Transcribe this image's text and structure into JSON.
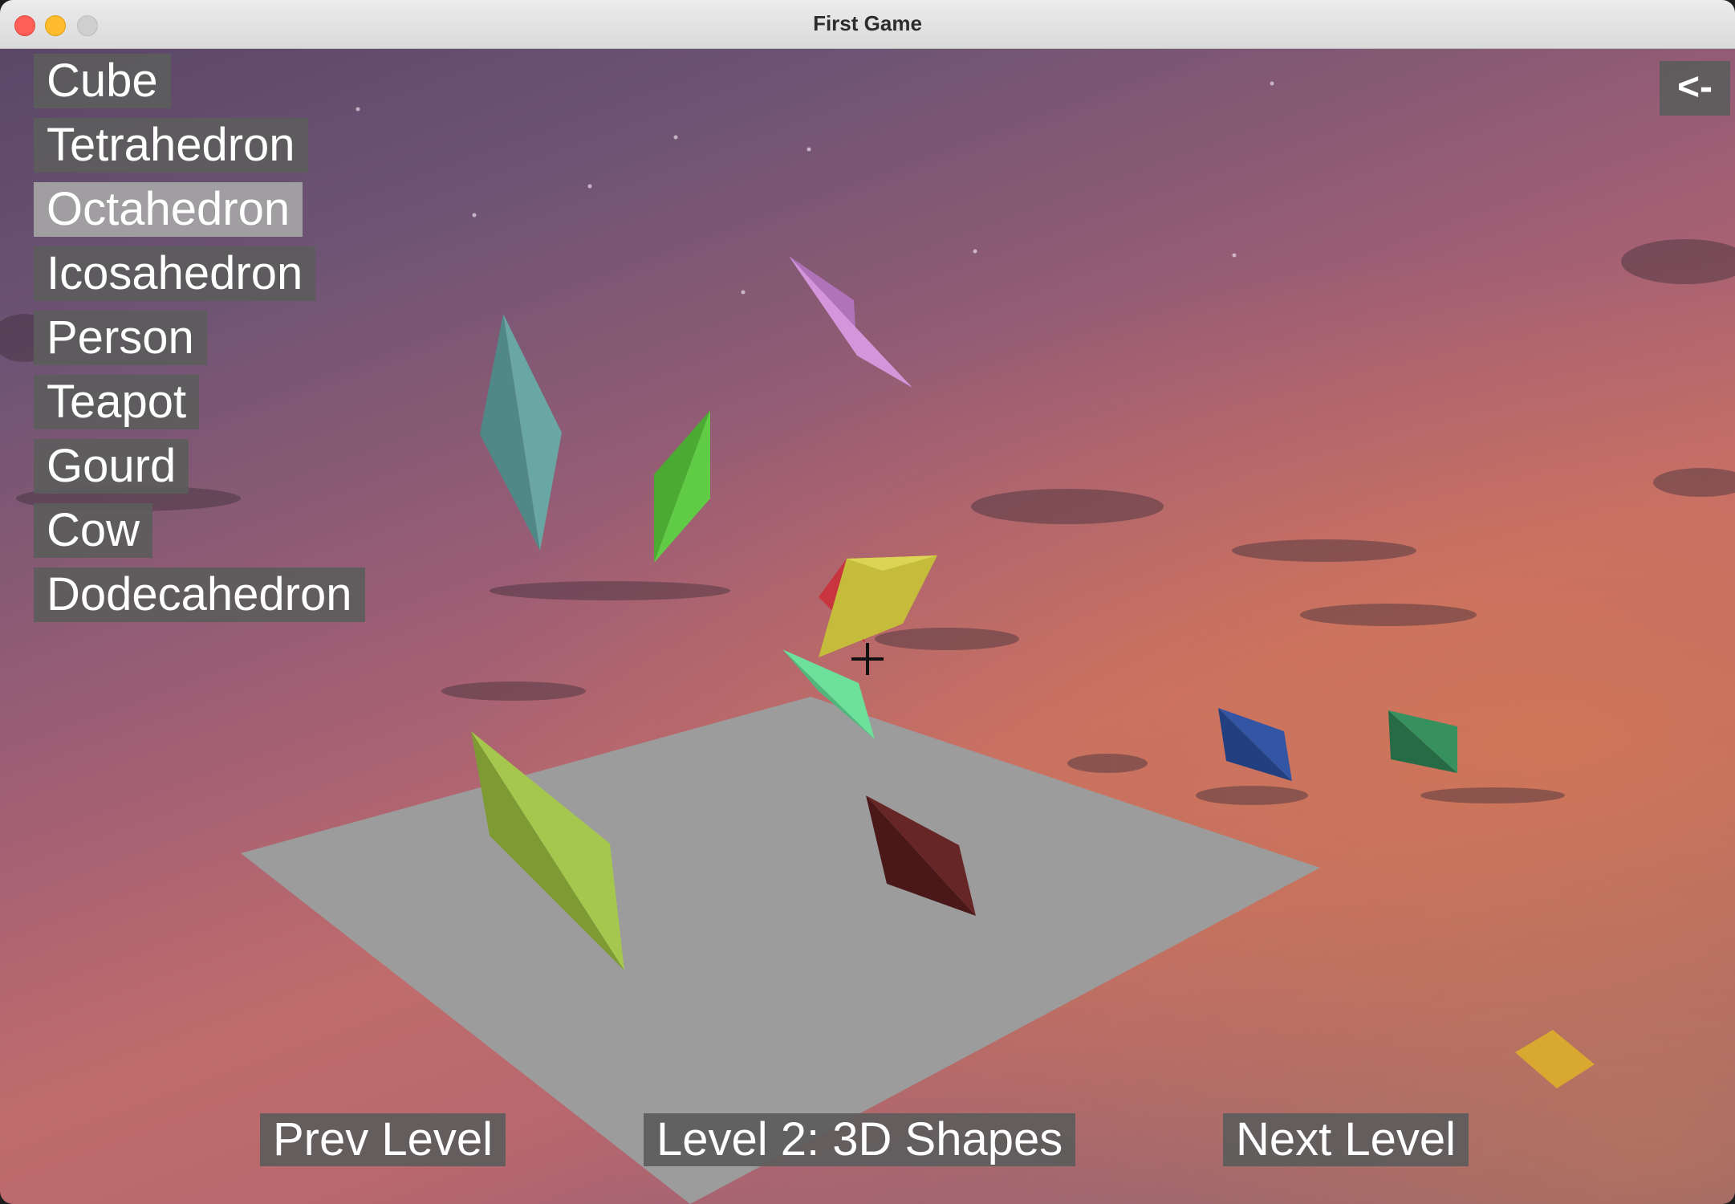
{
  "window": {
    "title": "First Game"
  },
  "menu": {
    "items": [
      {
        "label": "Cube"
      },
      {
        "label": "Tetrahedron"
      },
      {
        "label": "Octahedron",
        "active": true
      },
      {
        "label": "Icosahedron"
      },
      {
        "label": "Person"
      },
      {
        "label": "Teapot"
      },
      {
        "label": "Gourd"
      },
      {
        "label": "Cow"
      },
      {
        "label": "Dodecahedron"
      }
    ]
  },
  "back_button": {
    "label": "<-"
  },
  "footer": {
    "prev_label": "Prev Level",
    "level_label": "Level 2: 3D Shapes",
    "next_label": "Next Level"
  },
  "scene": {
    "floor_color": "#9c9c9c",
    "shape_colors": {
      "teal": "#5f9a98",
      "green": "#55c23c",
      "violet": "#c885cf",
      "yellow": "#c8c03f",
      "mint": "#5fd28e",
      "lime": "#9cbc45",
      "maroon": "#5c2020",
      "blue": "#2a4a94",
      "emerald": "#2f8055",
      "gold": "#d8a830"
    }
  }
}
